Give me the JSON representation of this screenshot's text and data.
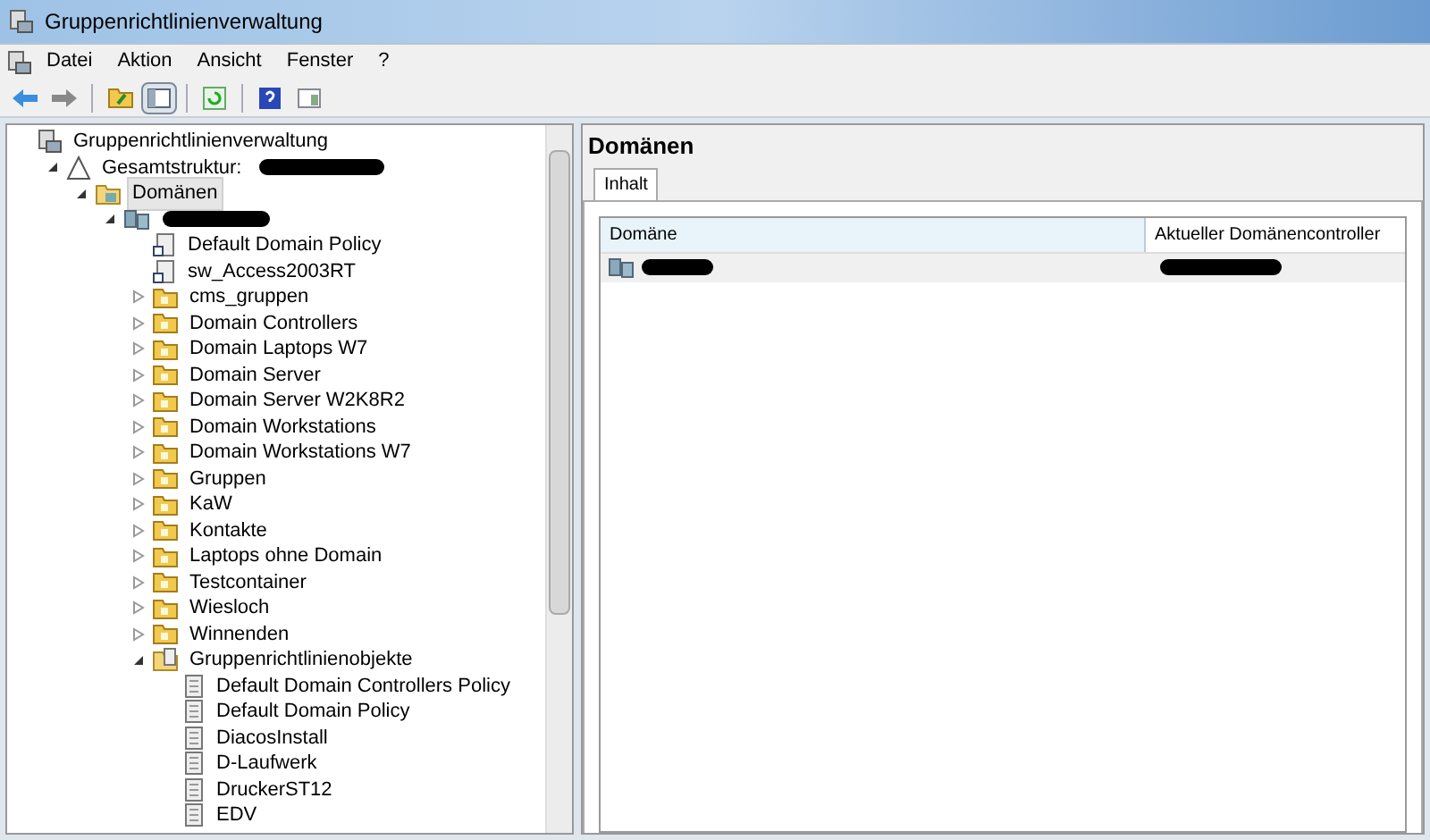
{
  "window": {
    "title": "Gruppenrichtlinienverwaltung"
  },
  "menu": [
    "Datei",
    "Aktion",
    "Ansicht",
    "Fenster",
    "?"
  ],
  "toolbar": [
    {
      "kind": "back"
    },
    {
      "kind": "forward"
    },
    {
      "kind": "sep"
    },
    {
      "kind": "up"
    },
    {
      "kind": "pane",
      "selected": true
    },
    {
      "kind": "sep"
    },
    {
      "kind": "refresh"
    },
    {
      "kind": "sep"
    },
    {
      "kind": "help"
    },
    {
      "kind": "pane2"
    }
  ],
  "tree": {
    "label": "Gruppenrichtlinienverwaltung",
    "kind": "root",
    "children": [
      {
        "label": "Gesamtstruktur:",
        "kind": "forest",
        "redacted": true,
        "expanded": true,
        "children": [
          {
            "label": "Domänen",
            "kind": "domains",
            "selected": true,
            "expanded": true,
            "children": [
              {
                "kind": "domain",
                "redacted": true,
                "expanded": true,
                "children": [
                  {
                    "label": "Default Domain Policy",
                    "kind": "link"
                  },
                  {
                    "label": "sw_Access2003RT",
                    "kind": "link"
                  },
                  {
                    "label": "cms_gruppen",
                    "kind": "ou",
                    "expanded": false
                  },
                  {
                    "label": "Domain Controllers",
                    "kind": "ou",
                    "expanded": false
                  },
                  {
                    "label": "Domain Laptops W7",
                    "kind": "ou",
                    "expanded": false
                  },
                  {
                    "label": "Domain Server",
                    "kind": "ou",
                    "expanded": false
                  },
                  {
                    "label": "Domain Server W2K8R2",
                    "kind": "ou",
                    "expanded": false
                  },
                  {
                    "label": "Domain Workstations",
                    "kind": "ou",
                    "expanded": false
                  },
                  {
                    "label": "Domain Workstations W7",
                    "kind": "ou",
                    "expanded": false
                  },
                  {
                    "label": "Gruppen",
                    "kind": "ou",
                    "expanded": false
                  },
                  {
                    "label": "KaW",
                    "kind": "ou",
                    "expanded": false
                  },
                  {
                    "label": "Kontakte",
                    "kind": "ou",
                    "expanded": false
                  },
                  {
                    "label": "Laptops ohne Domain",
                    "kind": "ou",
                    "expanded": false
                  },
                  {
                    "label": "Testcontainer",
                    "kind": "ou",
                    "expanded": false
                  },
                  {
                    "label": "Wiesloch",
                    "kind": "ou",
                    "expanded": false
                  },
                  {
                    "label": "Winnenden",
                    "kind": "ou",
                    "expanded": false
                  },
                  {
                    "label": "Gruppenrichtlinienobjekte",
                    "kind": "gpofolder",
                    "expanded": true,
                    "children": [
                      {
                        "label": "Default Domain Controllers Policy",
                        "kind": "gpo"
                      },
                      {
                        "label": "Default Domain Policy",
                        "kind": "gpo"
                      },
                      {
                        "label": "DiacosInstall",
                        "kind": "gpo"
                      },
                      {
                        "label": "D-Laufwerk",
                        "kind": "gpo"
                      },
                      {
                        "label": "DruckerST12",
                        "kind": "gpo"
                      },
                      {
                        "label": "EDV",
                        "kind": "gpo"
                      }
                    ]
                  }
                ]
              }
            ]
          }
        ]
      }
    ]
  },
  "content": {
    "title": "Domänen",
    "tabs": [
      {
        "label": "Inhalt",
        "selected": true
      }
    ],
    "table": {
      "columns": [
        "Domäne",
        "Aktueller Domänencontroller"
      ],
      "rows": [
        {
          "redacted": true
        }
      ]
    }
  }
}
